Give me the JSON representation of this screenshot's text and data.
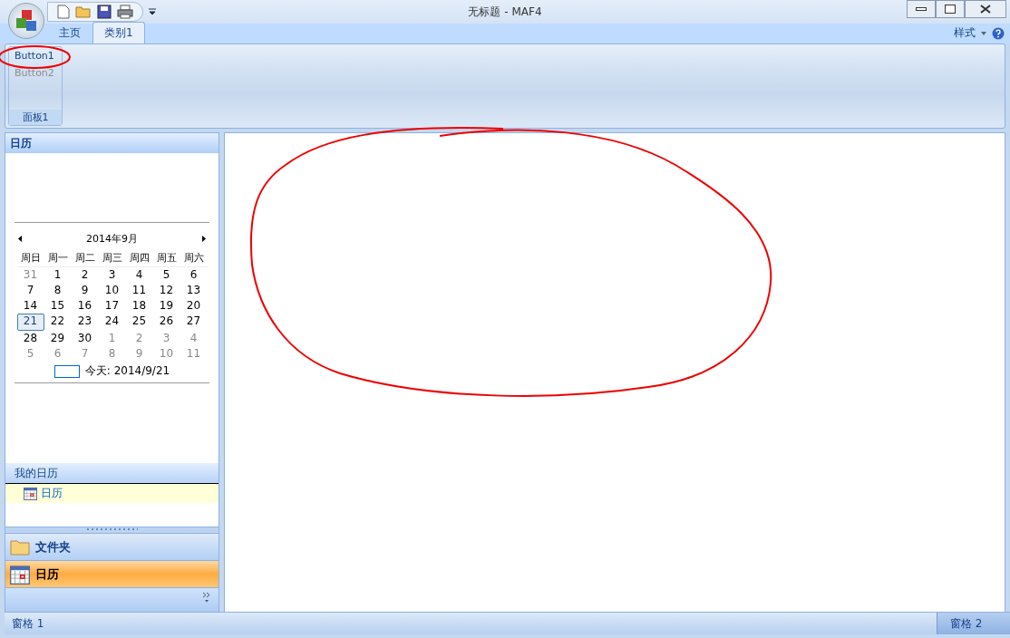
{
  "window": {
    "title": "无标题 - MAF4"
  },
  "tabs": [
    {
      "label": "主页",
      "selected": false
    },
    {
      "label": "类别1",
      "selected": true
    }
  ],
  "style_menu": {
    "label": "样式"
  },
  "ribbon": {
    "panels": [
      {
        "title": "面板1",
        "buttons": [
          {
            "label": "Button1",
            "disabled": false,
            "circled": true
          },
          {
            "label": "Button2",
            "disabled": true,
            "circled": false
          }
        ]
      }
    ]
  },
  "nav_pane": {
    "header": "日历",
    "calendar": {
      "month": "2014年9月",
      "weekdays": [
        "周日",
        "周一",
        "周二",
        "周三",
        "周四",
        "周五",
        "周六"
      ],
      "days": [
        {
          "text": "31",
          "muted": true,
          "selected": false
        },
        {
          "text": "1",
          "muted": false,
          "selected": false
        },
        {
          "text": "2",
          "muted": false,
          "selected": false
        },
        {
          "text": "3",
          "muted": false,
          "selected": false
        },
        {
          "text": "4",
          "muted": false,
          "selected": false
        },
        {
          "text": "5",
          "muted": false,
          "selected": false
        },
        {
          "text": "6",
          "muted": false,
          "selected": false
        },
        {
          "text": "7",
          "muted": false,
          "selected": false
        },
        {
          "text": "8",
          "muted": false,
          "selected": false
        },
        {
          "text": "9",
          "muted": false,
          "selected": false
        },
        {
          "text": "10",
          "muted": false,
          "selected": false
        },
        {
          "text": "11",
          "muted": false,
          "selected": false
        },
        {
          "text": "12",
          "muted": false,
          "selected": false
        },
        {
          "text": "13",
          "muted": false,
          "selected": false
        },
        {
          "text": "14",
          "muted": false,
          "selected": false
        },
        {
          "text": "15",
          "muted": false,
          "selected": false
        },
        {
          "text": "16",
          "muted": false,
          "selected": false
        },
        {
          "text": "17",
          "muted": false,
          "selected": false
        },
        {
          "text": "18",
          "muted": false,
          "selected": false
        },
        {
          "text": "19",
          "muted": false,
          "selected": false
        },
        {
          "text": "20",
          "muted": false,
          "selected": false
        },
        {
          "text": "21",
          "muted": false,
          "selected": true
        },
        {
          "text": "22",
          "muted": false,
          "selected": false
        },
        {
          "text": "23",
          "muted": false,
          "selected": false
        },
        {
          "text": "24",
          "muted": false,
          "selected": false
        },
        {
          "text": "25",
          "muted": false,
          "selected": false
        },
        {
          "text": "26",
          "muted": false,
          "selected": false
        },
        {
          "text": "27",
          "muted": false,
          "selected": false
        },
        {
          "text": "28",
          "muted": false,
          "selected": false
        },
        {
          "text": "29",
          "muted": false,
          "selected": false
        },
        {
          "text": "30",
          "muted": false,
          "selected": false
        },
        {
          "text": "1",
          "muted": true,
          "selected": false
        },
        {
          "text": "2",
          "muted": true,
          "selected": false
        },
        {
          "text": "3",
          "muted": true,
          "selected": false
        },
        {
          "text": "4",
          "muted": true,
          "selected": false
        },
        {
          "text": "5",
          "muted": true,
          "selected": false
        },
        {
          "text": "6",
          "muted": true,
          "selected": false
        },
        {
          "text": "7",
          "muted": true,
          "selected": false
        },
        {
          "text": "8",
          "muted": true,
          "selected": false
        },
        {
          "text": "9",
          "muted": true,
          "selected": false
        },
        {
          "text": "10",
          "muted": true,
          "selected": false
        },
        {
          "text": "11",
          "muted": true,
          "selected": false
        }
      ],
      "today": "今天: 2014/9/21"
    },
    "my_calendars": {
      "header": "我的日历",
      "items": [
        {
          "label": "日历",
          "selected": true
        }
      ]
    },
    "buttons": [
      {
        "label": "文件夹",
        "kind": "folder",
        "selected": false
      },
      {
        "label": "日历",
        "kind": "calendar",
        "selected": true
      }
    ]
  },
  "annotation": {
    "main_circle": true
  },
  "status_bar": {
    "left": "窗格 1",
    "right": "窗格 2"
  }
}
